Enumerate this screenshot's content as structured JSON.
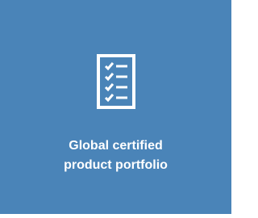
{
  "tile": {
    "icon": "checklist-icon",
    "line1": "Global certified",
    "line2": "product portfolio",
    "background_color": "#4a84b8",
    "text_color": "#ffffff"
  }
}
